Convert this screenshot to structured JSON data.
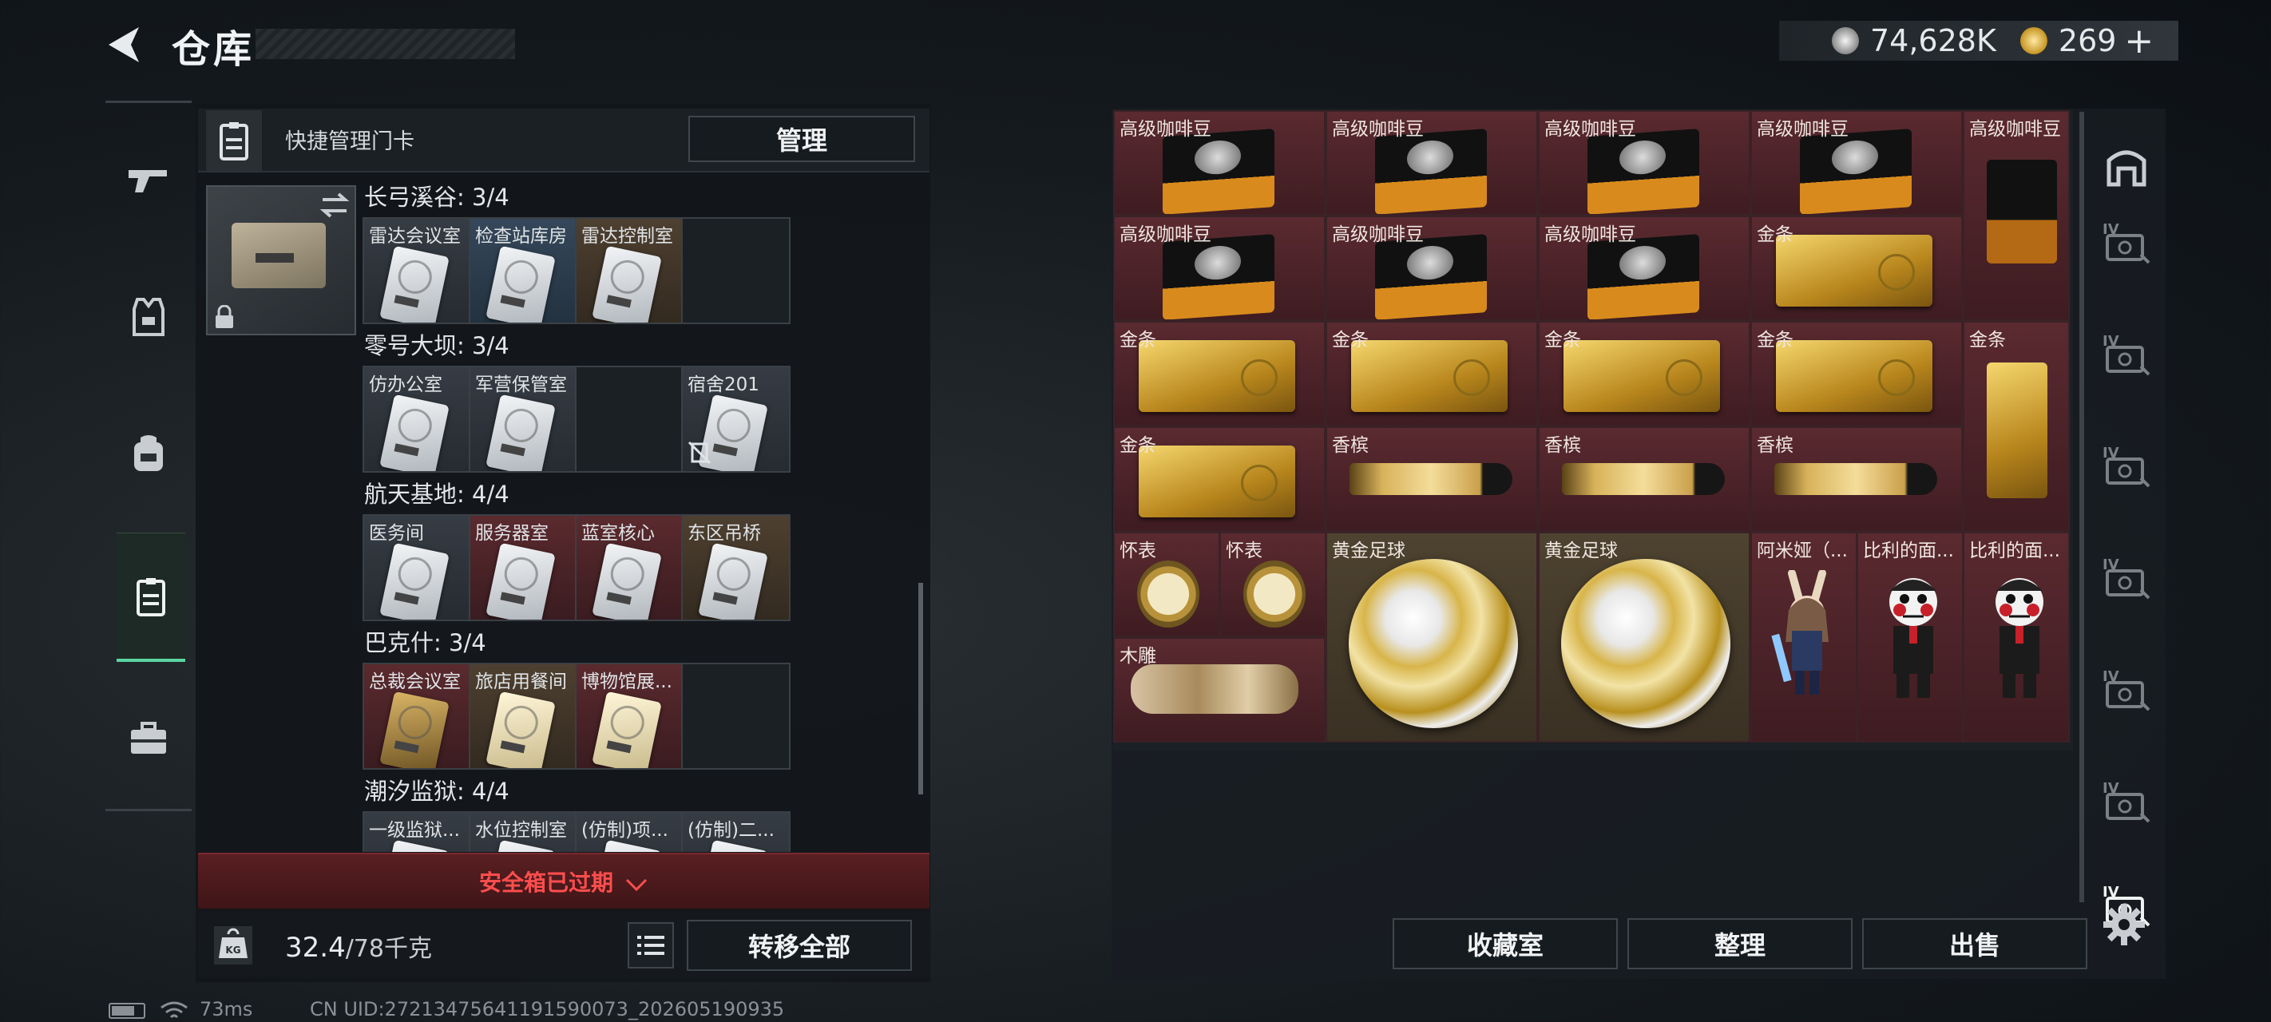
{
  "header": {
    "title": "仓库"
  },
  "currency": {
    "silver": "74,628K",
    "gold": "269",
    "plus": "+"
  },
  "keycard_panel": {
    "title": "快捷管理门卡",
    "manage_label": "管理",
    "regions": [
      {
        "name": "长弓溪谷: 3/4",
        "slots": [
          {
            "name": "雷达会议室",
            "color": "grey"
          },
          {
            "name": "检查站库房",
            "color": "blue"
          },
          {
            "name": "雷达控制室",
            "color": "brown"
          },
          {
            "name": "",
            "color": "empty"
          }
        ]
      },
      {
        "name": "零号大坝: 3/4",
        "slots": [
          {
            "name": "仿办公室",
            "color": "grey"
          },
          {
            "name": "军营保管室",
            "color": "grey"
          },
          {
            "name": "",
            "color": "empty"
          },
          {
            "name": "宿舍201",
            "color": "grey"
          }
        ]
      },
      {
        "name": "航天基地: 4/4",
        "slots": [
          {
            "name": "医务间",
            "color": "grey"
          },
          {
            "name": "服务器室",
            "color": "red"
          },
          {
            "name": "蓝室核心",
            "color": "red"
          },
          {
            "name": "东区吊桥",
            "color": "brown"
          }
        ]
      },
      {
        "name": "巴克什: 3/4",
        "slots": [
          {
            "name": "总裁会议室",
            "color": "red"
          },
          {
            "name": "旅店用餐间",
            "color": "brown"
          },
          {
            "name": "博物馆展...",
            "color": "red"
          },
          {
            "name": "",
            "color": "empty"
          }
        ]
      },
      {
        "name": "潮汐监狱: 4/4",
        "slots": [
          {
            "name": "一级监狱...",
            "color": "grey"
          },
          {
            "name": "水位控制室",
            "color": "grey"
          },
          {
            "name": "(仿制)项...",
            "color": "grey"
          },
          {
            "name": "(仿制)二...",
            "color": "grey"
          }
        ]
      }
    ],
    "safe_box": "安全箱已过期",
    "weight": "32.4",
    "weight_max": "/78千克",
    "transfer_all": "转移全部"
  },
  "items": [
    {
      "name": "高级咖啡豆",
      "rarity": "red",
      "art": "coffee"
    },
    {
      "name": "高级咖啡豆",
      "rarity": "red",
      "art": "coffee"
    },
    {
      "name": "高级咖啡豆",
      "rarity": "red",
      "art": "coffee"
    },
    {
      "name": "高级咖啡豆",
      "rarity": "red",
      "art": "coffee"
    },
    {
      "name": "高级咖啡豆",
      "rarity": "red",
      "art": "coffee-tall"
    },
    {
      "name": "高级咖啡豆",
      "rarity": "red",
      "art": "coffee"
    },
    {
      "name": "高级咖啡豆",
      "rarity": "red",
      "art": "coffee"
    },
    {
      "name": "高级咖啡豆",
      "rarity": "red",
      "art": "coffee"
    },
    {
      "name": "金条",
      "rarity": "red",
      "art": "gold-h"
    },
    {
      "name": "金条",
      "rarity": "red",
      "art": "gold-h"
    },
    {
      "name": "金条",
      "rarity": "red",
      "art": "gold-h"
    },
    {
      "name": "金条",
      "rarity": "red",
      "art": "gold-h"
    },
    {
      "name": "金条",
      "rarity": "red",
      "art": "gold-h"
    },
    {
      "name": "金条",
      "rarity": "red",
      "art": "gold-v"
    },
    {
      "name": "金条",
      "rarity": "red",
      "art": "gold-h"
    },
    {
      "name": "香槟",
      "rarity": "red",
      "art": "champ"
    },
    {
      "name": "香槟",
      "rarity": "red",
      "art": "champ"
    },
    {
      "name": "香槟",
      "rarity": "red",
      "art": "champ"
    },
    {
      "name": "怀表",
      "rarity": "red",
      "art": "watch"
    },
    {
      "name": "怀表",
      "rarity": "red",
      "art": "watch"
    },
    {
      "name": "黄金足球",
      "rarity": "yellow",
      "art": "ball"
    },
    {
      "name": "黄金足球",
      "rarity": "yellow",
      "art": "ball"
    },
    {
      "name": "阿米娅（...",
      "rarity": "red",
      "art": "figure"
    },
    {
      "name": "比利的面...",
      "rarity": "red",
      "art": "doll"
    },
    {
      "name": "比利的面...",
      "rarity": "red",
      "art": "doll"
    },
    {
      "name": "木雕",
      "rarity": "red",
      "art": "carving"
    }
  ],
  "actions": {
    "collection": "收藏室",
    "sort": "整理",
    "sell": "出售"
  },
  "right_nav": {
    "tier_label": "IV"
  },
  "status": {
    "ping": "73ms",
    "uid": "CN UID:27213475641191590073_202605190935"
  },
  "colors": {
    "accent": "#5bd4a2",
    "danger": "#ff4d4d",
    "rare_red": "#5a2a30",
    "gold_yellow": "#4e4330"
  }
}
